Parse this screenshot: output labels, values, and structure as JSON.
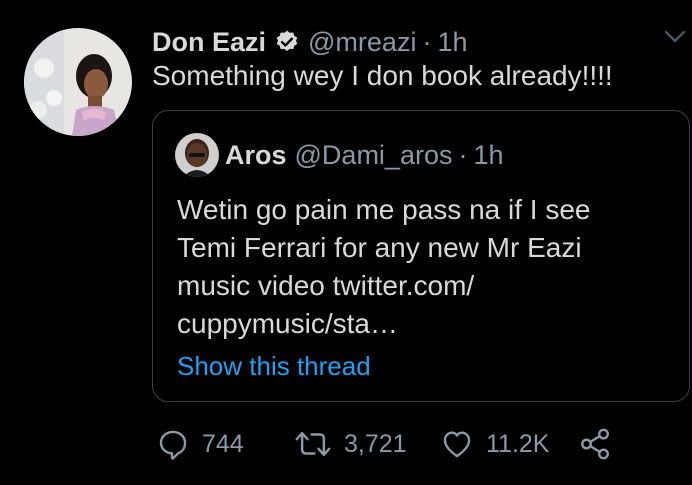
{
  "tweet": {
    "display_name": "Don Eazi",
    "handle": "@mreazi",
    "separator": "·",
    "time": "1h",
    "text": "Something wey I don book already!!!!",
    "verified_icon": "verified-badge-icon",
    "menu_icon": "chevron-down-icon"
  },
  "quote": {
    "display_name": "Aros",
    "handle": "@Dami_aros",
    "separator": "·",
    "time": "1h",
    "text_lines": [
      "Wetin go pain me pass na if I see",
      "Temi Ferrari for any new Mr Eazi",
      "music video twitter.com/",
      "cuppymusic/sta…"
    ],
    "show_thread": "Show this thread"
  },
  "actions": {
    "reply_count": "744",
    "retweet_count": "3,721",
    "like_count": "11.2K",
    "icons": [
      "reply-icon",
      "retweet-icon",
      "like-icon",
      "share-icon"
    ]
  },
  "colors": {
    "background": "#000000",
    "text": "#d9d9d9",
    "secondary": "#8b98a5",
    "link": "#1da1f2",
    "border": "#38444d"
  }
}
